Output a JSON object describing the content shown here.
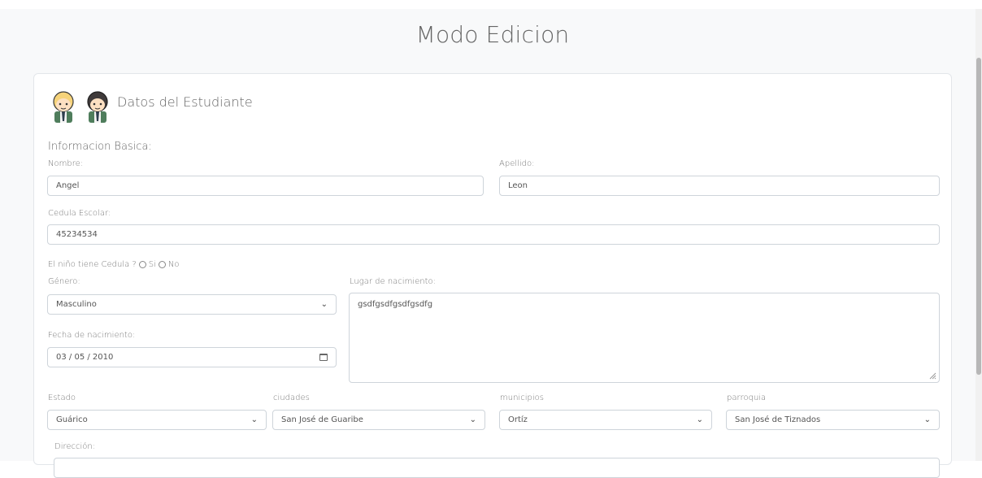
{
  "page": {
    "title": "Modo Edicion"
  },
  "card": {
    "title": "Datos del Estudiante",
    "icons": [
      "boy-student-icon",
      "girl-student-icon"
    ]
  },
  "form": {
    "section_title": "Informacion Basica:",
    "nombre": {
      "label": "Nombre:",
      "value": "Angel"
    },
    "apellido": {
      "label": "Apellido:",
      "value": "Leon"
    },
    "cedula": {
      "label": "Cedula Escolar:",
      "value": "45234534"
    },
    "tiene_cedula": {
      "label": "El niño tiene Cedula ?",
      "option_si": "Si",
      "option_no": "No"
    },
    "genero": {
      "label": "Género:",
      "value": "Masculino"
    },
    "lugar": {
      "label": "Lugar de nacimiento:",
      "value": "gsdfgsdfgsdfgsdfg"
    },
    "fecha": {
      "label": "Fecha de nacimiento:",
      "value": "03 / 05 / 2010"
    },
    "estado": {
      "label": "Estado",
      "value": "Guárico"
    },
    "ciudades": {
      "label": "ciudades",
      "value": "San José de Guaribe"
    },
    "municipios": {
      "label": "municipios",
      "value": "Ortíz"
    },
    "parroquia": {
      "label": "parroquia",
      "value": "San José de Tiznados"
    },
    "direccion": {
      "label": "Dirección:"
    }
  }
}
